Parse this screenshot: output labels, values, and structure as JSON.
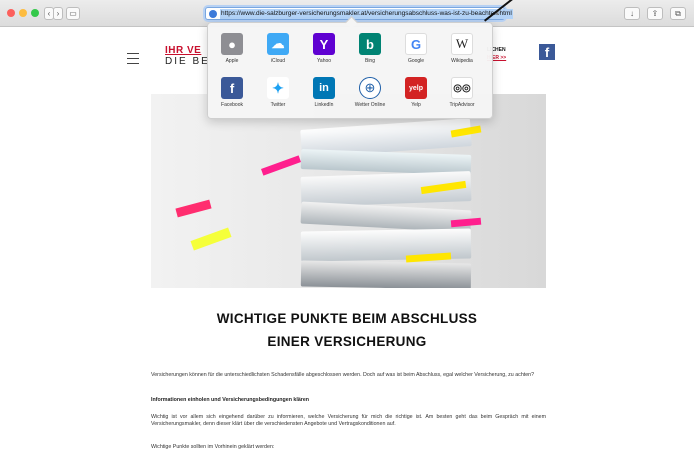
{
  "browser": {
    "url": "https://www.die-salzburger-versicherungsmakler.at/versicherungsabschluss-was-ist-zu-beachten.html"
  },
  "header": {
    "brand_line1": "IHR VE",
    "brand_line2": "DIE BE",
    "link1": "LICHEN",
    "link2": "HIER >>",
    "facebook_glyph": "f"
  },
  "favorites": [
    {
      "label": "Apple",
      "glyph": "",
      "color": "#8e8e93",
      "icon": "apple-icon"
    },
    {
      "label": "iCloud",
      "glyph": "☁",
      "color": "#3fa9f5",
      "icon": "icloud-icon"
    },
    {
      "label": "Yahoo",
      "glyph": "Y",
      "color": "#5f01d1",
      "icon": "yahoo-icon"
    },
    {
      "label": "Bing",
      "glyph": "b",
      "color": "#008373",
      "icon": "bing-icon"
    },
    {
      "label": "Google",
      "glyph": "G",
      "color": "#ffffff",
      "icon": "google-icon"
    },
    {
      "label": "Wikipedia",
      "glyph": "W",
      "color": "#ffffff",
      "icon": "wikipedia-icon"
    },
    {
      "label": "Facebook",
      "glyph": "f",
      "color": "#3b5998",
      "icon": "facebook-icon"
    },
    {
      "label": "Twitter",
      "glyph": "🐦",
      "color": "#ffffff",
      "icon": "twitter-icon"
    },
    {
      "label": "LinkedIn",
      "glyph": "in",
      "color": "#0077b5",
      "icon": "linkedin-icon"
    },
    {
      "label": "Wetter Online",
      "glyph": "⊕",
      "color": "#ffffff",
      "icon": "wetter-online-icon"
    },
    {
      "label": "Yelp",
      "glyph": "yelp",
      "color": "#d32323",
      "icon": "yelp-icon"
    },
    {
      "label": "TripAdvisor",
      "glyph": "◎◎",
      "color": "#ffffff",
      "icon": "tripadvisor-icon"
    }
  ],
  "article": {
    "title_line1": "WICHTIGE PUNKTE BEIM ABSCHLUSS",
    "title_line2": "EINER VERSICHERUNG",
    "intro": "Versicherungen können für die unterschiedlichsten Schadensfälle abgeschlossen werden. Doch auf was ist beim Abschluss, egal welcher Versicherung, zu achten?",
    "subheading": "Informationen einholen und Versicherungsbedingungen klären",
    "body": "Wichtig ist vor allem sich eingehend darüber zu informieren, welche Versicherung für mich die richtige ist. Am besten geht das beim Gespräch mit einem Versicherungsmakler, denn dieser klärt über die verschiedensten Angebote und Vertragskonditionen auf.",
    "body2": "Wichtige Punkte sollten im Vorhinein geklärt werden:"
  }
}
